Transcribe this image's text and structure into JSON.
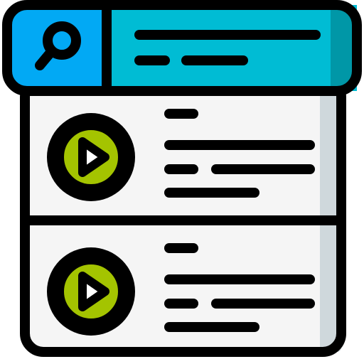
{
  "icon": {
    "name": "video-search-results-icon",
    "colors": {
      "outline": "#000000",
      "search_box": "#02a9f4",
      "header_bar": "#00bcd4",
      "header_shadow": "#0097a7",
      "panel": "#f5f5f5",
      "panel_shadow": "#cfd8dc",
      "play_circle": "#a4c400",
      "play_triangle": "#ffffff"
    },
    "parts": {
      "search_icon": "search-icon",
      "play_icon": "play-icon",
      "text_line": "text-line"
    },
    "results": [
      {
        "id": "result-1"
      },
      {
        "id": "result-2"
      }
    ]
  }
}
